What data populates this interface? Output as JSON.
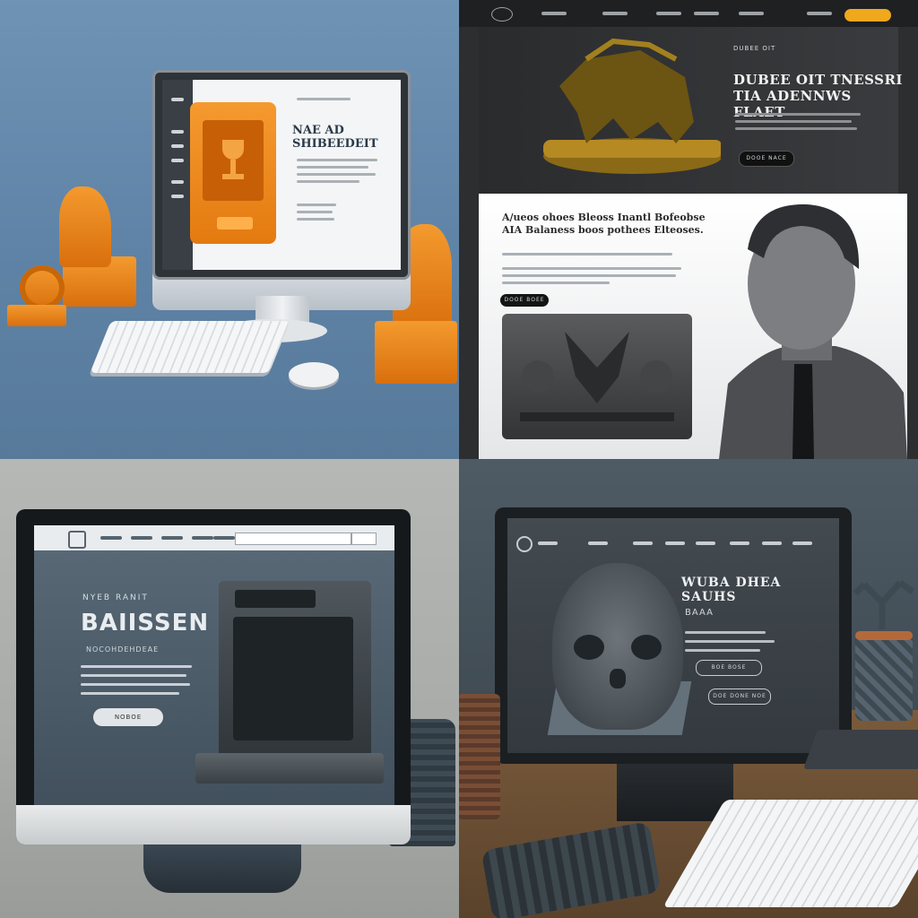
{
  "panels": {
    "a": {
      "headline_line1": "NAE AD",
      "headline_line2": "SHIBEEDEIT"
    },
    "b": {
      "eyebrow": "DUBEE OIT",
      "hero_line1": "DUBEE OIT TNESSRI",
      "hero_line2": "TIA ADENNWS FLAET",
      "sub_line1": "A/ueos ohoes Bleoss Inantl Bofeobse",
      "sub_line2": "AIA Balaness boos pothees Elteoses.",
      "hero_cta": "DOOE NACE",
      "sub_cta": "DOOE BOEE"
    },
    "c": {
      "small_head": "NYEB RANIT",
      "big_title": "BAIISSEN",
      "tagline": "NOCOHDEHDEAE",
      "cta": "NOBOE"
    },
    "d": {
      "title": "WUBA DHEA SAUHS",
      "subtitle": "BAAA",
      "cta1": "BOE BOSE",
      "cta2": "DOE DONE NOE"
    }
  },
  "icons": {
    "printer": "3d-printer-icon",
    "trophy": "trophy-icon",
    "skull": "skull-mask-icon",
    "logo": "logo-icon"
  },
  "colors": {
    "orange": "#f0891f",
    "gold_button": "#f0a81c",
    "dark": "#1f2022"
  }
}
